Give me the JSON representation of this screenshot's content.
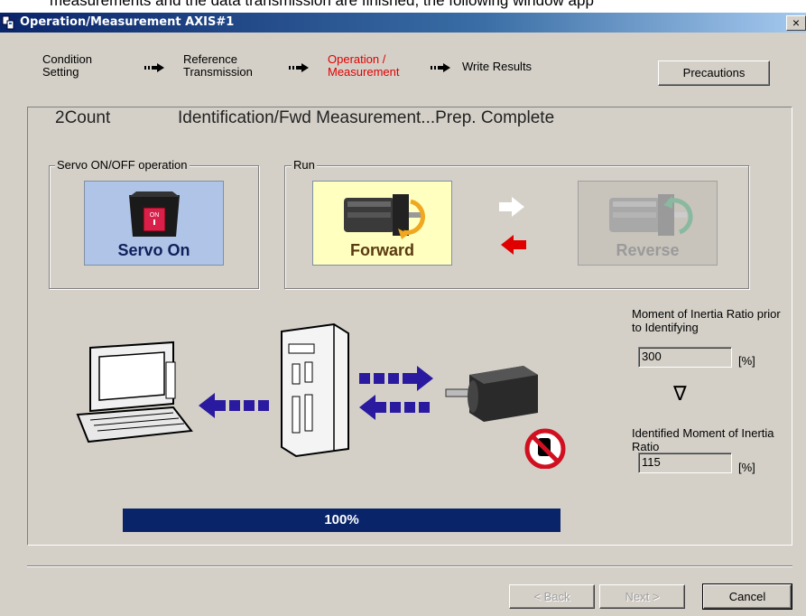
{
  "top_text": "measurements and the data transmission are finished, the following window app",
  "window": {
    "title": "Operation/Measurement AXIS#1",
    "close": "×"
  },
  "steps": [
    {
      "line1": "Condition",
      "line2": "Setting"
    },
    {
      "line1": "Reference",
      "line2": "Transmission"
    },
    {
      "line1": "Operation /",
      "line2": "Measurement"
    },
    {
      "line1": "Write Results",
      "line2": ""
    }
  ],
  "active_step_color": "#e00000",
  "precautions_label": "Precautions",
  "status": {
    "count": "2Count",
    "message": "Identification/Fwd Measurement...Prep. Complete"
  },
  "servo_group": {
    "label": "Servo ON/OFF operation",
    "button_label": "Servo On",
    "switch_text": "ON"
  },
  "run_group": {
    "label": "Run",
    "forward_label": "Forward",
    "reverse_label": "Reverse"
  },
  "inertia": {
    "prior_label": "Moment of Inertia Ratio prior to Identifying",
    "prior_value": "300",
    "identified_label": "Identified Moment of Inertia Ratio",
    "identified_value": "115",
    "unit": "[%]",
    "down_symbol": "∇"
  },
  "progress": {
    "text": "100%",
    "value": 1.0
  },
  "buttons": {
    "back": "< Back",
    "next": "Next >",
    "cancel": "Cancel"
  },
  "colors": {
    "title_start": "#0a246a",
    "progress": "#0a246a",
    "servo_bg": "#b0c4e8",
    "forward_bg": "#ffffc0",
    "arrow_blue": "#2a1aa0",
    "arrow_red": "#e00000"
  }
}
